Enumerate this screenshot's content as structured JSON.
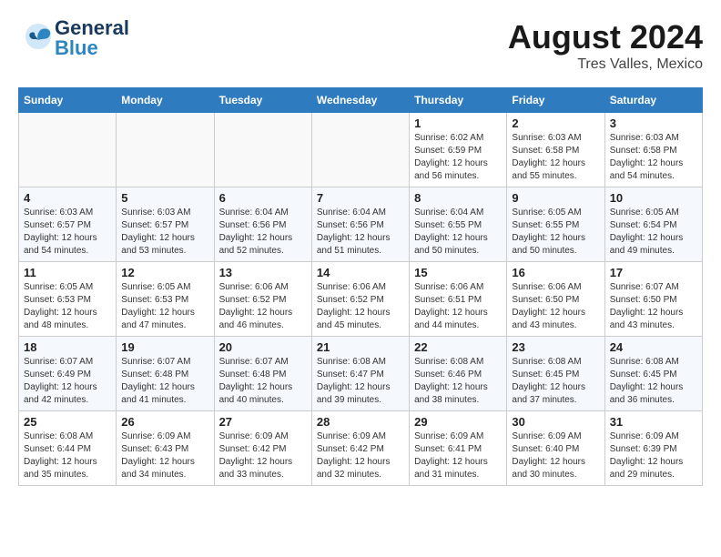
{
  "header": {
    "logo_text_general": "General",
    "logo_text_blue": "Blue",
    "month_year": "August 2024",
    "location": "Tres Valles, Mexico"
  },
  "days_of_week": [
    "Sunday",
    "Monday",
    "Tuesday",
    "Wednesday",
    "Thursday",
    "Friday",
    "Saturday"
  ],
  "weeks": [
    [
      {
        "day": "",
        "empty": true
      },
      {
        "day": "",
        "empty": true
      },
      {
        "day": "",
        "empty": true
      },
      {
        "day": "",
        "empty": true
      },
      {
        "day": "1",
        "sunrise": "Sunrise: 6:02 AM",
        "sunset": "Sunset: 6:59 PM",
        "daylight": "Daylight: 12 hours and 56 minutes."
      },
      {
        "day": "2",
        "sunrise": "Sunrise: 6:03 AM",
        "sunset": "Sunset: 6:58 PM",
        "daylight": "Daylight: 12 hours and 55 minutes."
      },
      {
        "day": "3",
        "sunrise": "Sunrise: 6:03 AM",
        "sunset": "Sunset: 6:58 PM",
        "daylight": "Daylight: 12 hours and 54 minutes."
      }
    ],
    [
      {
        "day": "4",
        "sunrise": "Sunrise: 6:03 AM",
        "sunset": "Sunset: 6:57 PM",
        "daylight": "Daylight: 12 hours and 54 minutes."
      },
      {
        "day": "5",
        "sunrise": "Sunrise: 6:03 AM",
        "sunset": "Sunset: 6:57 PM",
        "daylight": "Daylight: 12 hours and 53 minutes."
      },
      {
        "day": "6",
        "sunrise": "Sunrise: 6:04 AM",
        "sunset": "Sunset: 6:56 PM",
        "daylight": "Daylight: 12 hours and 52 minutes."
      },
      {
        "day": "7",
        "sunrise": "Sunrise: 6:04 AM",
        "sunset": "Sunset: 6:56 PM",
        "daylight": "Daylight: 12 hours and 51 minutes."
      },
      {
        "day": "8",
        "sunrise": "Sunrise: 6:04 AM",
        "sunset": "Sunset: 6:55 PM",
        "daylight": "Daylight: 12 hours and 50 minutes."
      },
      {
        "day": "9",
        "sunrise": "Sunrise: 6:05 AM",
        "sunset": "Sunset: 6:55 PM",
        "daylight": "Daylight: 12 hours and 50 minutes."
      },
      {
        "day": "10",
        "sunrise": "Sunrise: 6:05 AM",
        "sunset": "Sunset: 6:54 PM",
        "daylight": "Daylight: 12 hours and 49 minutes."
      }
    ],
    [
      {
        "day": "11",
        "sunrise": "Sunrise: 6:05 AM",
        "sunset": "Sunset: 6:53 PM",
        "daylight": "Daylight: 12 hours and 48 minutes."
      },
      {
        "day": "12",
        "sunrise": "Sunrise: 6:05 AM",
        "sunset": "Sunset: 6:53 PM",
        "daylight": "Daylight: 12 hours and 47 minutes."
      },
      {
        "day": "13",
        "sunrise": "Sunrise: 6:06 AM",
        "sunset": "Sunset: 6:52 PM",
        "daylight": "Daylight: 12 hours and 46 minutes."
      },
      {
        "day": "14",
        "sunrise": "Sunrise: 6:06 AM",
        "sunset": "Sunset: 6:52 PM",
        "daylight": "Daylight: 12 hours and 45 minutes."
      },
      {
        "day": "15",
        "sunrise": "Sunrise: 6:06 AM",
        "sunset": "Sunset: 6:51 PM",
        "daylight": "Daylight: 12 hours and 44 minutes."
      },
      {
        "day": "16",
        "sunrise": "Sunrise: 6:06 AM",
        "sunset": "Sunset: 6:50 PM",
        "daylight": "Daylight: 12 hours and 43 minutes."
      },
      {
        "day": "17",
        "sunrise": "Sunrise: 6:07 AM",
        "sunset": "Sunset: 6:50 PM",
        "daylight": "Daylight: 12 hours and 43 minutes."
      }
    ],
    [
      {
        "day": "18",
        "sunrise": "Sunrise: 6:07 AM",
        "sunset": "Sunset: 6:49 PM",
        "daylight": "Daylight: 12 hours and 42 minutes."
      },
      {
        "day": "19",
        "sunrise": "Sunrise: 6:07 AM",
        "sunset": "Sunset: 6:48 PM",
        "daylight": "Daylight: 12 hours and 41 minutes."
      },
      {
        "day": "20",
        "sunrise": "Sunrise: 6:07 AM",
        "sunset": "Sunset: 6:48 PM",
        "daylight": "Daylight: 12 hours and 40 minutes."
      },
      {
        "day": "21",
        "sunrise": "Sunrise: 6:08 AM",
        "sunset": "Sunset: 6:47 PM",
        "daylight": "Daylight: 12 hours and 39 minutes."
      },
      {
        "day": "22",
        "sunrise": "Sunrise: 6:08 AM",
        "sunset": "Sunset: 6:46 PM",
        "daylight": "Daylight: 12 hours and 38 minutes."
      },
      {
        "day": "23",
        "sunrise": "Sunrise: 6:08 AM",
        "sunset": "Sunset: 6:45 PM",
        "daylight": "Daylight: 12 hours and 37 minutes."
      },
      {
        "day": "24",
        "sunrise": "Sunrise: 6:08 AM",
        "sunset": "Sunset: 6:45 PM",
        "daylight": "Daylight: 12 hours and 36 minutes."
      }
    ],
    [
      {
        "day": "25",
        "sunrise": "Sunrise: 6:08 AM",
        "sunset": "Sunset: 6:44 PM",
        "daylight": "Daylight: 12 hours and 35 minutes."
      },
      {
        "day": "26",
        "sunrise": "Sunrise: 6:09 AM",
        "sunset": "Sunset: 6:43 PM",
        "daylight": "Daylight: 12 hours and 34 minutes."
      },
      {
        "day": "27",
        "sunrise": "Sunrise: 6:09 AM",
        "sunset": "Sunset: 6:42 PM",
        "daylight": "Daylight: 12 hours and 33 minutes."
      },
      {
        "day": "28",
        "sunrise": "Sunrise: 6:09 AM",
        "sunset": "Sunset: 6:42 PM",
        "daylight": "Daylight: 12 hours and 32 minutes."
      },
      {
        "day": "29",
        "sunrise": "Sunrise: 6:09 AM",
        "sunset": "Sunset: 6:41 PM",
        "daylight": "Daylight: 12 hours and 31 minutes."
      },
      {
        "day": "30",
        "sunrise": "Sunrise: 6:09 AM",
        "sunset": "Sunset: 6:40 PM",
        "daylight": "Daylight: 12 hours and 30 minutes."
      },
      {
        "day": "31",
        "sunrise": "Sunrise: 6:09 AM",
        "sunset": "Sunset: 6:39 PM",
        "daylight": "Daylight: 12 hours and 29 minutes."
      }
    ]
  ]
}
